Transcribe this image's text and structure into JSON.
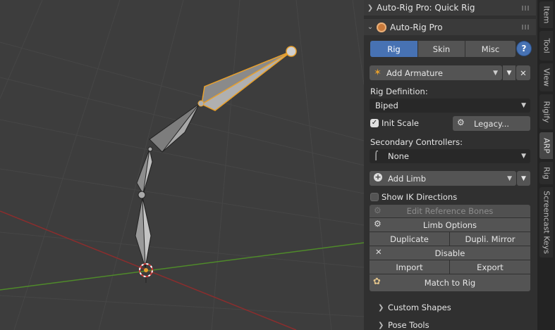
{
  "sidebar_tabs": [
    "Item",
    "Tool",
    "View",
    "Rigify",
    "ARP",
    "Rig",
    "Screencast Keys"
  ],
  "quick_rig_panel": {
    "title": "Auto-Rig Pro: Quick Rig"
  },
  "arp_panel": {
    "title": "Auto-Rig Pro",
    "tabs": [
      "Rig",
      "Skin",
      "Misc"
    ],
    "active_tab": "Rig",
    "help_label": "?",
    "add_armature": {
      "label": "Add Armature"
    },
    "rig_definition": {
      "label": "Rig Definition:",
      "value": "Biped"
    },
    "init_scale": {
      "label": "Init Scale",
      "checked": true
    },
    "legacy_label": "Legacy...",
    "secondary_controllers": {
      "label": "Secondary Controllers:",
      "value": "None"
    },
    "add_limb": {
      "label": "Add Limb"
    },
    "show_ik": {
      "label": "Show IK Directions",
      "checked": false
    },
    "edit_ref_bones": "Edit Reference Bones",
    "limb_options": "Limb Options",
    "duplicate": "Duplicate",
    "dupli_mirror": "Dupli. Mirror",
    "disable": "Disable",
    "import": "Import",
    "export": "Export",
    "match_to_rig": "Match to Rig",
    "subpanels": [
      "Custom Shapes",
      "Pose Tools"
    ]
  },
  "colors": {
    "accent": "#4772b3",
    "selection": "#e8a02c",
    "x_axis": "#8b2d2d",
    "y_axis": "#4f8a2a"
  }
}
